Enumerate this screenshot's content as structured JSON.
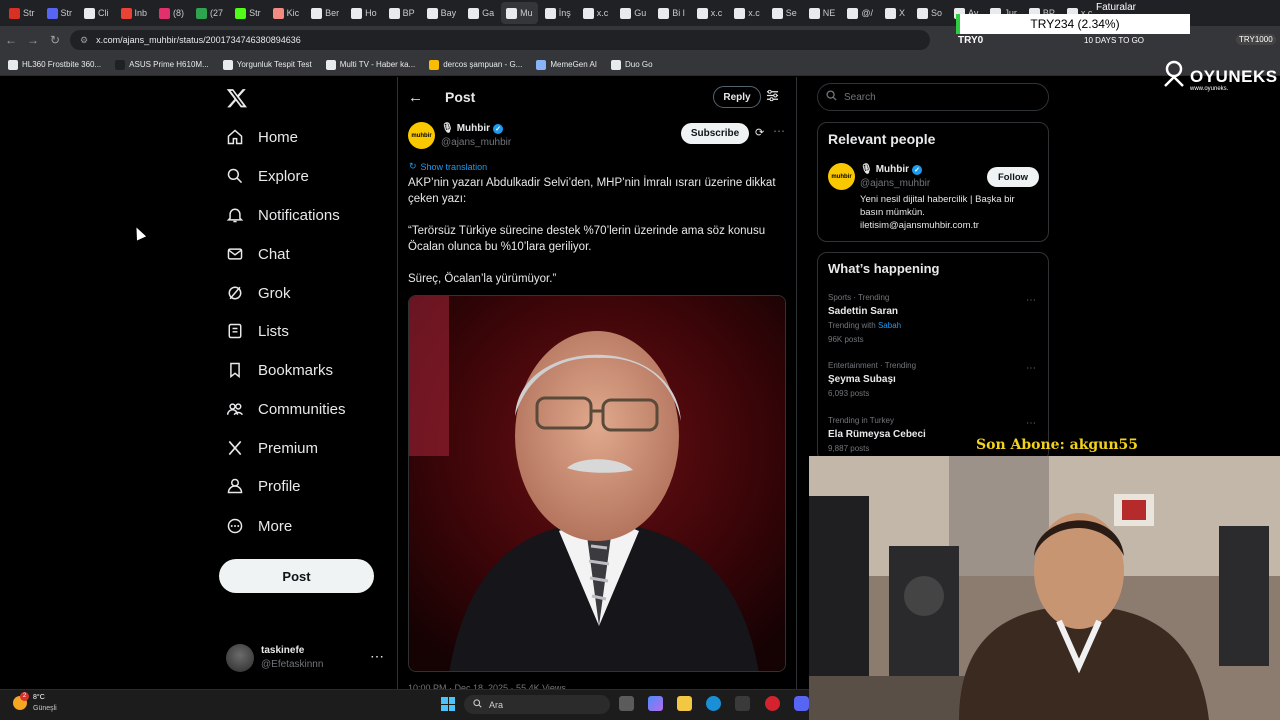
{
  "browser": {
    "tabs": [
      {
        "label": "Str",
        "color": "#d93025",
        "icon": "opera-icon"
      },
      {
        "label": "Str",
        "color": "#5865f2",
        "icon": "tab-icon"
      },
      {
        "label": "Cli",
        "color": "#e8eaed",
        "icon": "tab-icon"
      },
      {
        "label": "Inb",
        "color": "#ea4335",
        "icon": "gmail-icon"
      },
      {
        "label": "(8)",
        "color": "#e1306c",
        "icon": "instagram-icon"
      },
      {
        "label": "(27",
        "color": "#2ea44f",
        "icon": "tab-icon"
      },
      {
        "label": "Str",
        "color": "#53fc18",
        "icon": "kick-icon"
      },
      {
        "label": "Kic",
        "color": "#f28b82",
        "icon": "tab-icon"
      },
      {
        "label": "Ber",
        "color": "#e8eaed",
        "icon": "x-icon"
      },
      {
        "label": "Ho",
        "color": "#e8eaed",
        "icon": "x-icon"
      },
      {
        "label": "BP",
        "color": "#e8eaed",
        "icon": "x-icon"
      },
      {
        "label": "Bay",
        "color": "#e8eaed",
        "icon": "x-icon"
      },
      {
        "label": "Ga",
        "color": "#e8eaed",
        "icon": "x-icon"
      },
      {
        "label": "Mu",
        "color": "#e8eaed",
        "icon": "x-icon",
        "active": true
      },
      {
        "label": "İnş",
        "color": "#e8eaed",
        "icon": "x-icon"
      },
      {
        "label": "x.c",
        "color": "#e8eaed",
        "icon": "x-icon"
      },
      {
        "label": "Gu",
        "color": "#e8eaed",
        "icon": "x-icon"
      },
      {
        "label": "Bi l",
        "color": "#e8eaed",
        "icon": "x-icon"
      },
      {
        "label": "x.c",
        "color": "#e8eaed",
        "icon": "x-icon"
      },
      {
        "label": "x.c",
        "color": "#e8eaed",
        "icon": "x-icon"
      },
      {
        "label": "Se",
        "color": "#e8eaed",
        "icon": "x-icon"
      },
      {
        "label": "NE",
        "color": "#e8eaed",
        "icon": "x-icon"
      },
      {
        "label": "@/",
        "color": "#e8eaed",
        "icon": "x-icon"
      },
      {
        "label": "X",
        "color": "#e8eaed",
        "icon": "x-icon"
      },
      {
        "label": "So",
        "color": "#e8eaed",
        "icon": "x-icon"
      },
      {
        "label": "Ay",
        "color": "#e8eaed",
        "icon": "x-icon"
      },
      {
        "label": "Jur",
        "color": "#e8eaed",
        "icon": "x-icon"
      },
      {
        "label": "BP",
        "color": "#e8eaed",
        "icon": "x-icon"
      },
      {
        "label": "x.c",
        "color": "#e8eaed",
        "icon": "x-icon"
      }
    ],
    "url": "x.com/ajans_muhbir/status/2001734746380894636",
    "bookmarks": [
      {
        "label": "HL360 Frostbite 360...",
        "color": "#e8eaed"
      },
      {
        "label": "ASUS Prime H610M...",
        "color": "#202124"
      },
      {
        "label": "Yorgunluk Tespit Test",
        "color": "#e8eaed"
      },
      {
        "label": "Multi TV - Haber ka...",
        "color": "#e8eaed"
      },
      {
        "label": "dercos şampuan - G...",
        "color": "#fbbc04"
      },
      {
        "label": "MemeGen AI",
        "color": "#8ab4f8"
      },
      {
        "label": "Duo Go",
        "color": "#e8eaed"
      }
    ]
  },
  "overlay": {
    "faturalar": "Faturalar",
    "ticker": "TRY234 (2.34%)",
    "try_label": "TRY0",
    "days_label": "10 DAYS TO GO",
    "try_badge": "TRY1000",
    "brand": "OYUNEKS",
    "brand_sub": "www.oyuneks.",
    "son_abone": "Son Abone: akgun55"
  },
  "nav": {
    "items": [
      {
        "label": "Home",
        "icon": "home-icon"
      },
      {
        "label": "Explore",
        "icon": "search-icon"
      },
      {
        "label": "Notifications",
        "icon": "bell-icon"
      },
      {
        "label": "Chat",
        "icon": "mail-icon"
      },
      {
        "label": "Grok",
        "icon": "grok-icon"
      },
      {
        "label": "Lists",
        "icon": "list-icon"
      },
      {
        "label": "Bookmarks",
        "icon": "bookmark-icon"
      },
      {
        "label": "Communities",
        "icon": "people-icon"
      },
      {
        "label": "Premium",
        "icon": "x-icon"
      },
      {
        "label": "Profile",
        "icon": "person-icon"
      },
      {
        "label": "More",
        "icon": "more-circle-icon"
      }
    ],
    "post_label": "Post",
    "profile": {
      "name": "taskinefe",
      "handle": "@Efetaskinnn"
    }
  },
  "post": {
    "title": "Post",
    "reply_label": "Reply",
    "author": {
      "name": "Muhbir",
      "handle": "@ajans_muhbir",
      "avatar_text": "muhbir"
    },
    "subscribe_label": "Subscribe",
    "show_translation": "Show translation",
    "paragraphs": [
      "AKP’nin yazarı Abdulkadir Selvi’den, MHP’nin İmralı ısrarı üzerine dikkat çeken yazı:",
      "“Terörsüz Türkiye sürecine destek %70’lerin üzerinde ama söz konusu Öcalan olunca bu %10’lara geriliyor.",
      "Süreç, Öcalan’la yürümüyor.”"
    ],
    "meta": "10:00 PM · Dec 18, 2025 · 55.4K Views"
  },
  "sidebar": {
    "search_placeholder": "Search",
    "relevant_title": "Relevant people",
    "relevant": {
      "name": "Muhbir",
      "handle": "@ajans_muhbir",
      "follow_label": "Follow",
      "bio": "Yeni nesil dijital habercilik | Başka bir basın mümkün. iletisim@ajansmuhbir.com.tr"
    },
    "happening_title": "What’s happening",
    "trends": [
      {
        "meta": "Sports · Trending",
        "name": "Sadettin Saran",
        "with_label": "Trending with",
        "with_value": "Sabah",
        "posts": "96K posts"
      },
      {
        "meta": "Entertainment · Trending",
        "name": "Şeyma Subaşı",
        "posts": "6,093 posts"
      },
      {
        "meta": "Trending in Turkey",
        "name": "Ela Rümeysa Cebeci",
        "posts": "9,887 posts"
      }
    ]
  },
  "taskbar": {
    "weather_temp": "8°C",
    "weather_city": "Güneşli",
    "weather_badge": "2",
    "search_placeholder": "Ara"
  },
  "colors": {
    "accent": "#1d9bf0",
    "background": "#000000",
    "border": "#2f3336",
    "muhbir_yellow": "#f9c800",
    "overlay_gold": "#f2d21b"
  }
}
